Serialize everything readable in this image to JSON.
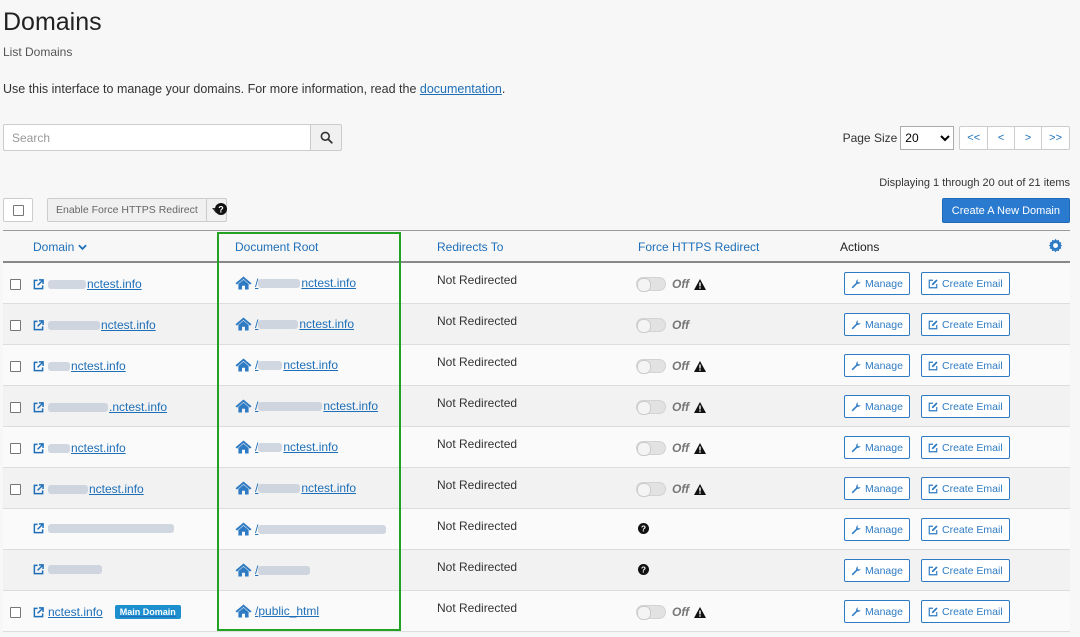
{
  "header": {
    "title": "Domains",
    "subtitle": "List Domains",
    "intro_text": "Use this interface to manage your domains. For more information, read the ",
    "doc_link": "documentation",
    "intro_end": "."
  },
  "search": {
    "placeholder": "Search"
  },
  "pagination": {
    "page_size_label": "Page Size",
    "page_size_value": "20",
    "first": "<<",
    "prev": "<",
    "next": ">",
    "last": ">>",
    "displaying": "Displaying 1 through 20 out of 21 items"
  },
  "bulk": {
    "action_label": "Enable Force HTTPS Redirect"
  },
  "create_button": "Create A New Domain",
  "columns": {
    "domain": "Domain",
    "document_root": "Document Root",
    "redirects_to": "Redirects To",
    "force_https": "Force HTTPS Redirect",
    "actions": "Actions"
  },
  "labels": {
    "manage": "Manage",
    "create_email": "Create Email",
    "off": "Off",
    "main_domain": "Main Domain"
  },
  "colors": {
    "link": "#1e6fb8",
    "primary_button": "#2a7bd0",
    "highlight_box": "#22a122",
    "badge": "#1d8fcf"
  },
  "rows": [
    {
      "domain": "nctest.info",
      "domain_blur": 38,
      "docroot": "nctest.info",
      "docroot_blur": 42,
      "redirect": "Not Redirected",
      "https": "off",
      "warning": true,
      "checkbox": true
    },
    {
      "domain": "nctest.info",
      "domain_blur": 52,
      "docroot": "nctest.info",
      "docroot_blur": 40,
      "redirect": "Not Redirected",
      "https": "off",
      "warning": false,
      "checkbox": true
    },
    {
      "domain": "nctest.info",
      "domain_blur": 22,
      "docroot": "nctest.info",
      "docroot_blur": 24,
      "redirect": "Not Redirected",
      "https": "off",
      "warning": true,
      "checkbox": true
    },
    {
      "domain": ".nctest.info",
      "domain_blur": 60,
      "docroot": "nctest.info",
      "docroot_blur": 64,
      "redirect": "Not Redirected",
      "https": "off",
      "warning": true,
      "checkbox": true
    },
    {
      "domain": "nctest.info",
      "domain_blur": 22,
      "docroot": "nctest.info",
      "docroot_blur": 24,
      "redirect": "Not Redirected",
      "https": "off",
      "warning": true,
      "checkbox": true
    },
    {
      "domain": "nctest.info",
      "domain_blur": 40,
      "docroot": "nctest.info",
      "docroot_blur": 42,
      "redirect": "Not Redirected",
      "https": "off",
      "warning": true,
      "checkbox": true
    },
    {
      "domain": "",
      "domain_blur": 126,
      "docroot": "",
      "docroot_blur": 128,
      "redirect": "Not Redirected",
      "https": "unavailable",
      "warning": false,
      "checkbox": false
    },
    {
      "domain": "",
      "domain_blur": 54,
      "docroot": "",
      "docroot_blur": 52,
      "redirect": "Not Redirected",
      "https": "unavailable",
      "warning": false,
      "checkbox": false
    },
    {
      "domain": "nctest.info",
      "domain_blur": 0,
      "docroot": "public_html",
      "docroot_blur": 0,
      "redirect": "Not Redirected",
      "https": "off",
      "warning": true,
      "checkbox": true,
      "main": true
    }
  ]
}
